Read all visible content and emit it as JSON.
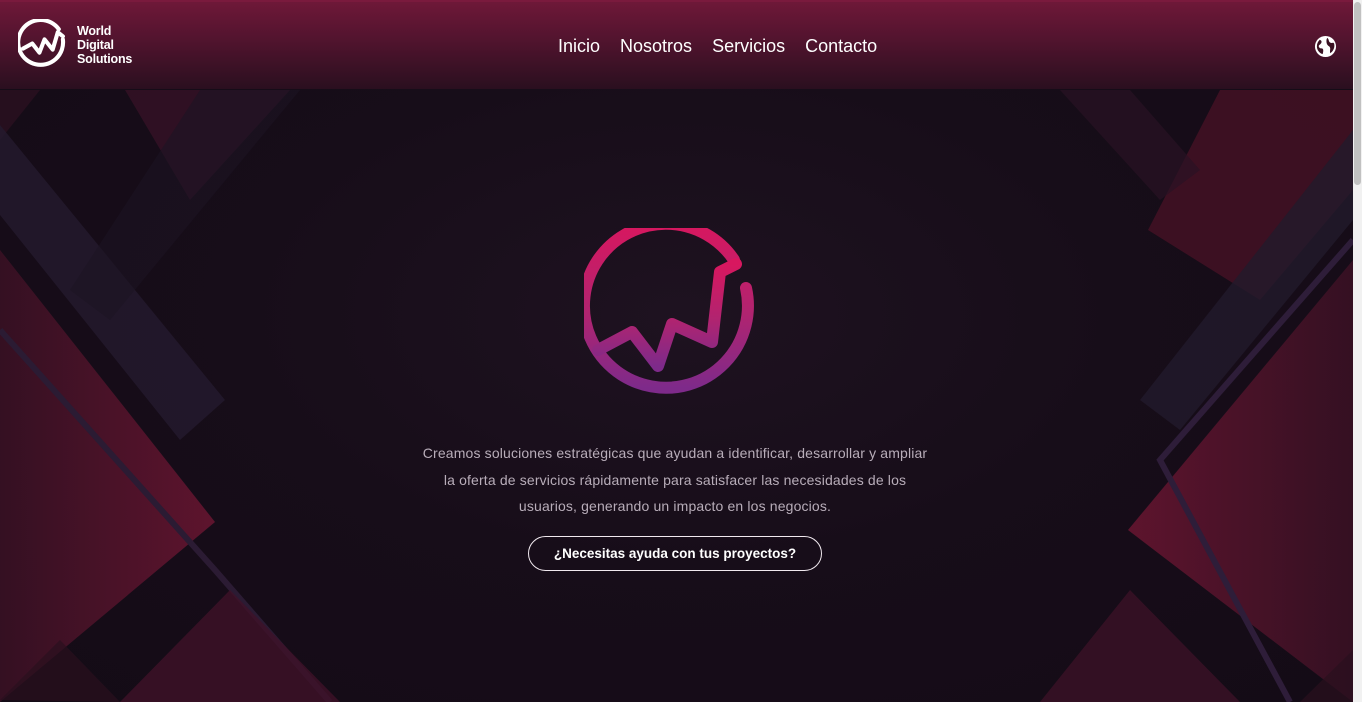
{
  "brand": {
    "line1": "World",
    "line2": "Digital",
    "line3": "Solutions",
    "logo_icon": "w-circle-logo-icon"
  },
  "nav": {
    "items": [
      {
        "label": "Inicio"
      },
      {
        "label": "Nosotros"
      },
      {
        "label": "Servicios"
      },
      {
        "label": "Contacto"
      }
    ],
    "language_icon": "globe-icon"
  },
  "hero": {
    "description_line1": "Creamos soluciones estratégicas que ayudan a identificar, desarrollar y ampliar",
    "description_line2": "la oferta de servicios rápidamente para satisfacer las necesidades de los",
    "description_line3": "usuarios, generando un impacto en los negocios.",
    "cta_label": "¿Necesitas ayuda con tus proyectos?",
    "logo_icon": "w-circle-gradient-logo-icon"
  },
  "colors": {
    "accent_pink": "#d81b60",
    "accent_purple": "#7b2a8c",
    "navbar_top": "#6e1838",
    "background": "#170d19"
  }
}
